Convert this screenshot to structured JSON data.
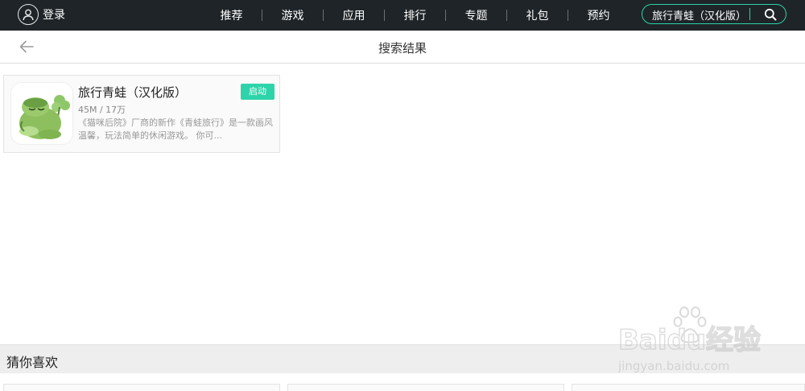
{
  "topbar": {
    "login_label": "登录",
    "nav": [
      "推荐",
      "游戏",
      "应用",
      "排行",
      "专题",
      "礼包",
      "预约"
    ],
    "search_value": "旅行青蛙（汉化版）",
    "accent": "#2ad4a8"
  },
  "header": {
    "title": "搜索结果"
  },
  "result": {
    "name": "旅行青蛙（汉化版）",
    "meta": "45M / 17万",
    "description": "《猫咪后院》厂商的新作《青蛙旅行》是一款画风温馨，玩法简单的休闲游戏。 你可...",
    "action_label": "启动",
    "action_color": "#2ed4a9"
  },
  "recommend": {
    "title": "猜你喜欢"
  },
  "watermark": {
    "brand": "Baidu经验",
    "url": "jingyan.baidu.com"
  }
}
